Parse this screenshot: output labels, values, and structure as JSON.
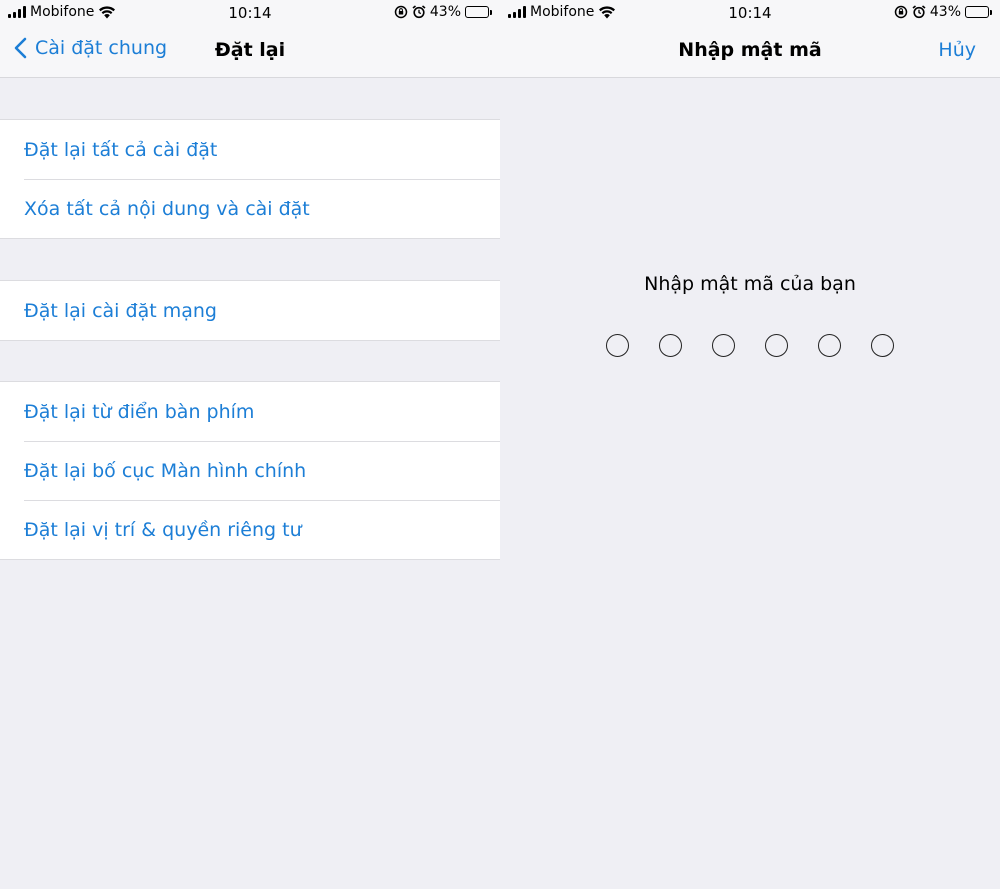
{
  "status": {
    "carrier": "Mobifone",
    "time": "10:14",
    "battery": "43%",
    "battery_level": 0.43
  },
  "left": {
    "back_label": "Cài đặt chung",
    "title": "Đặt lại",
    "groups": [
      [
        "Đặt lại tất cả cài đặt",
        "Xóa tất cả nội dung và cài đặt"
      ],
      [
        "Đặt lại cài đặt mạng"
      ],
      [
        "Đặt lại từ điển bàn phím",
        "Đặt lại bố cục Màn hình chính",
        "Đặt lại vị trí & quyền riêng tư"
      ]
    ]
  },
  "right": {
    "title": "Nhập mật mã",
    "cancel_label": "Hủy",
    "prompt": "Nhập mật mã của bạn",
    "passcode_length": 6,
    "entered_digits": 0
  },
  "colors": {
    "accent": "#1c7ed6",
    "background": "#efeff4",
    "cell": "#ffffff"
  },
  "icons": [
    "signal-icon",
    "wifi-icon",
    "orientation-lock-icon",
    "alarm-icon",
    "battery-icon",
    "chevron-left-icon"
  ]
}
